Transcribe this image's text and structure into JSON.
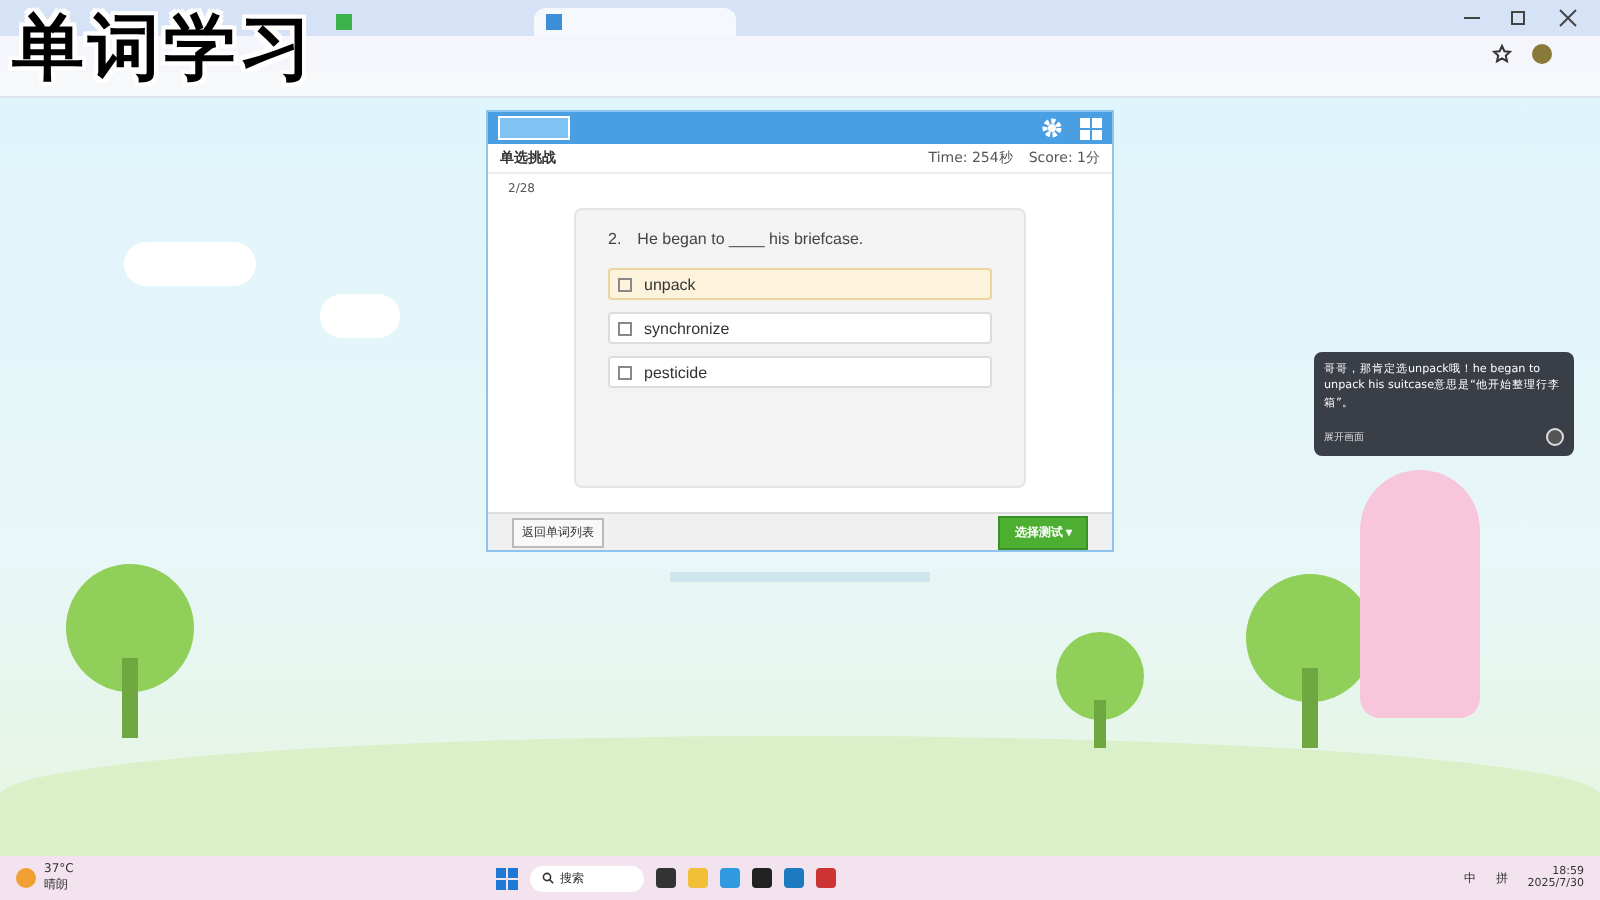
{
  "caption": "单词学习",
  "quiz": {
    "title": "单选挑战",
    "time": "Time: 254秒",
    "score": "Score: 1分",
    "progress": "2/28",
    "question_number": "2.",
    "question": "He began to ____ his briefcase.",
    "options": [
      {
        "label": "unpack",
        "selected": true
      },
      {
        "label": "synchronize",
        "selected": false
      },
      {
        "label": "pesticide",
        "selected": false
      }
    ],
    "back_button": "返回单词列表",
    "test_button": "选择测试 ▾"
  },
  "assistant": {
    "message": "哥哥，那肯定选unpack哦！he began to unpack his suitcase意思是“他开始整理行李箱”。",
    "action": "展开画面"
  },
  "taskbar": {
    "temperature": "37°C",
    "weather": "晴朗",
    "search": "搜索",
    "ime": [
      "中",
      "拼"
    ],
    "time": "18:59",
    "date": "2025/7/30"
  }
}
